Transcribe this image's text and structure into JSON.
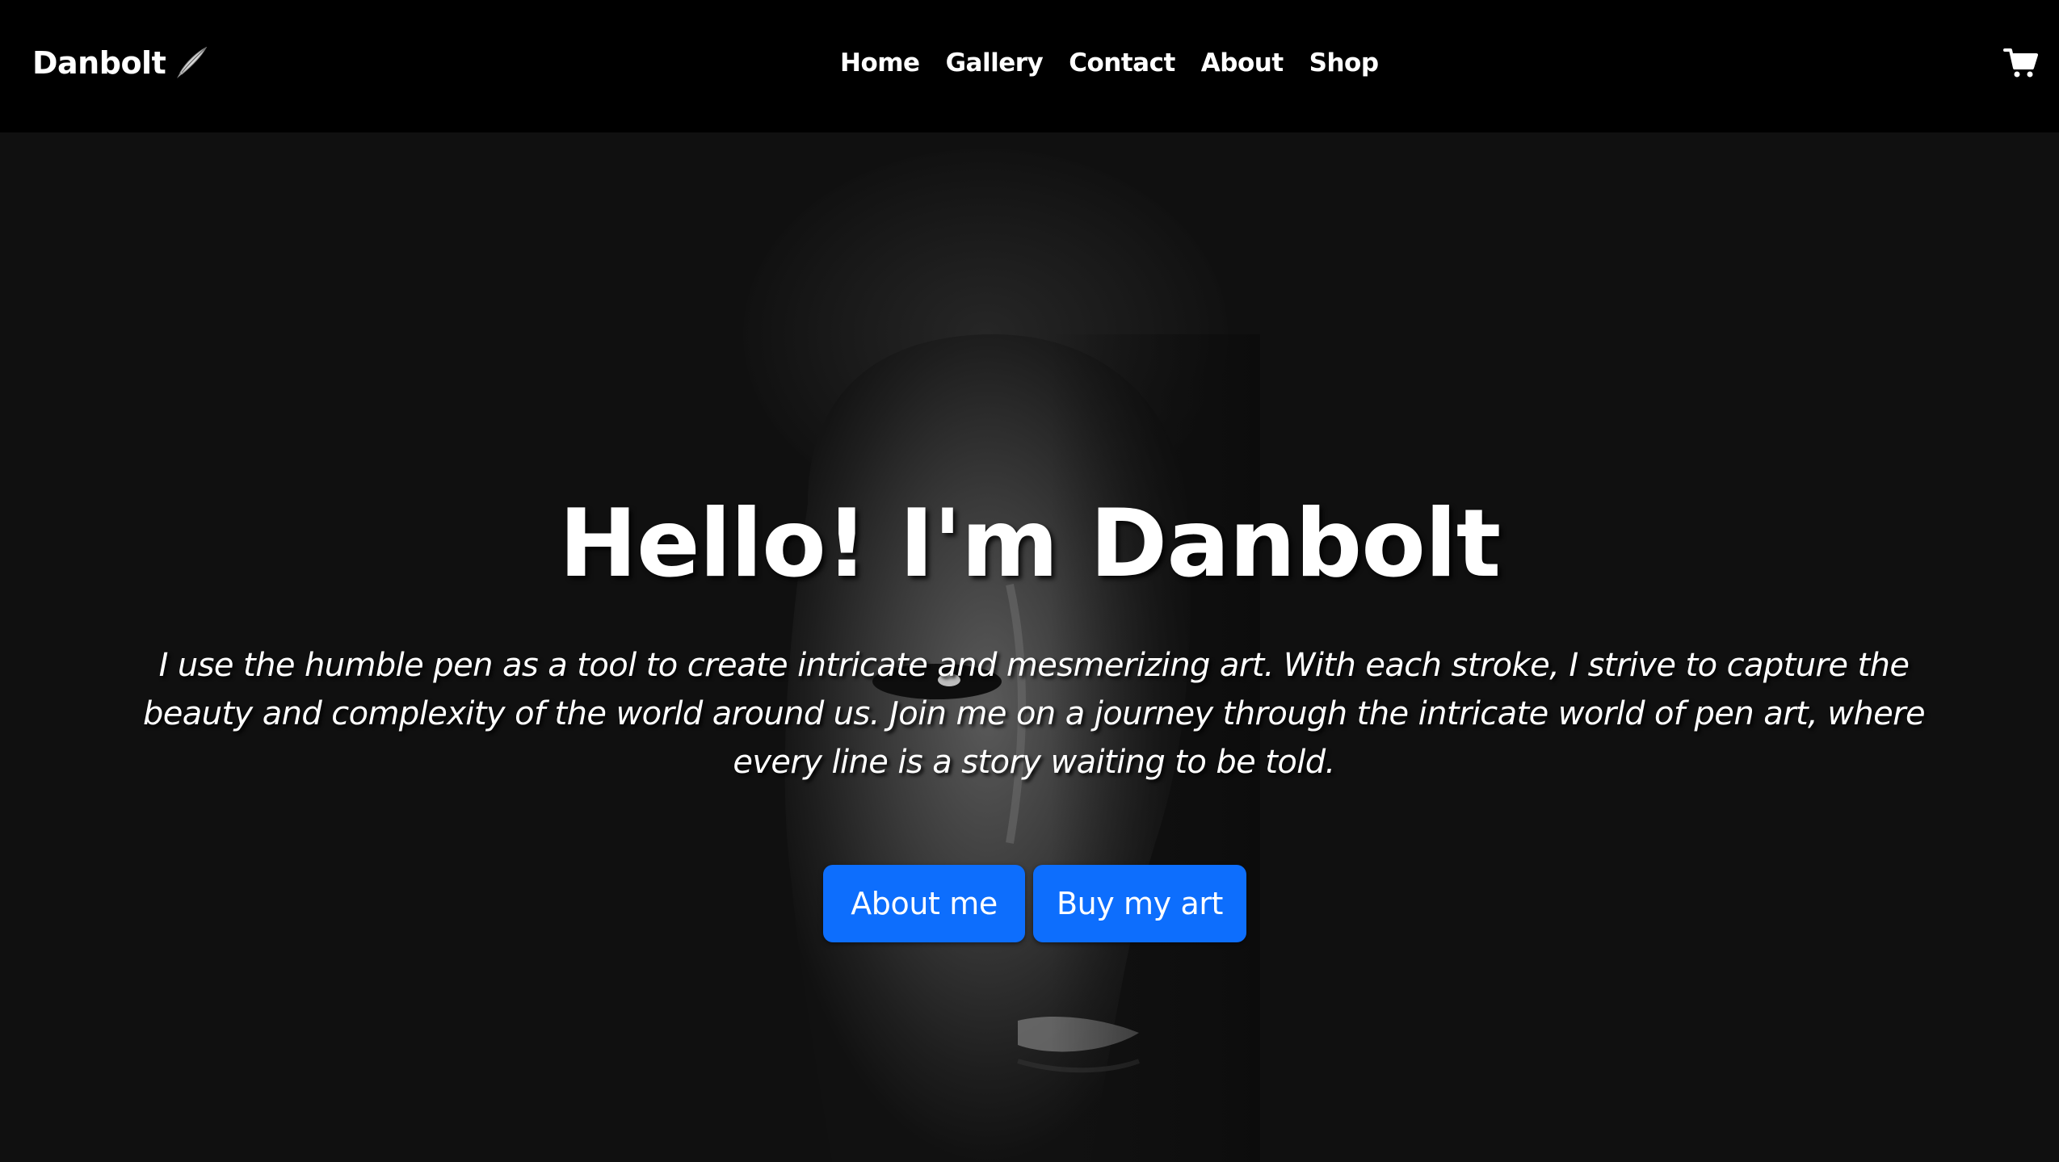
{
  "navbar": {
    "brand": "Danbolt",
    "brand_icon": "quill-pen-icon",
    "links": [
      {
        "label": "Home"
      },
      {
        "label": "Gallery"
      },
      {
        "label": "Contact"
      },
      {
        "label": "About"
      },
      {
        "label": "Shop"
      }
    ],
    "cart_icon": "shopping-cart-icon"
  },
  "hero": {
    "title": "Hello! I'm Danbolt",
    "text": "I use the humble pen as a tool to create intricate and mesmerizing art. With each stroke, I strive to capture the beauty and complexity of the world around us. Join me on a journey through the intricate world of pen art, where every line is a story waiting to be told.",
    "buttons": {
      "about": "About me",
      "buy": "Buy my art"
    }
  },
  "colors": {
    "navbar_bg": "#000000",
    "hero_bg": "#101010",
    "button_bg": "#0d6efd",
    "text": "#ffffff"
  }
}
